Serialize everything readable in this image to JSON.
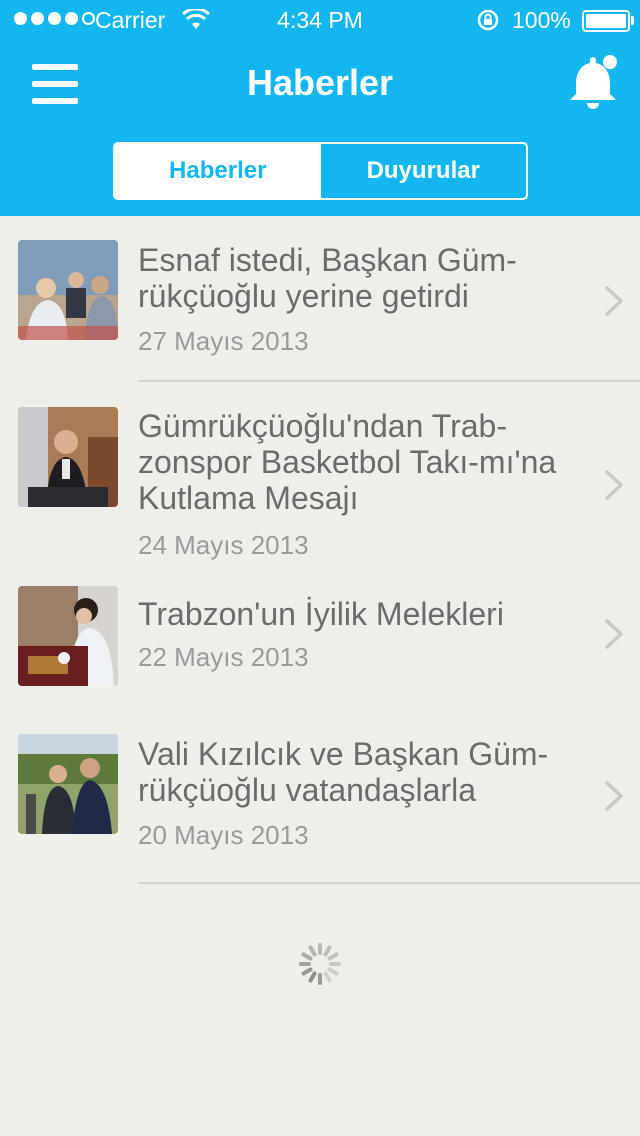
{
  "status_bar": {
    "carrier": "Carrier",
    "time": "4:34 PM",
    "battery": "100%"
  },
  "nav": {
    "title": "Haberler",
    "menu_icon": "hamburger-menu-icon",
    "bell_icon": "bell-icon"
  },
  "tabs": [
    {
      "label": "Haberler",
      "active": true
    },
    {
      "label": "Duyurular",
      "active": false
    }
  ],
  "news": [
    {
      "title": "Esnaf istedi, Başkan Güm-rükçüoğlu yerine getirdi",
      "date": "27 Mayıs 2013"
    },
    {
      "title": "Gümrükçüoğlu'ndan Trab-zonspor Basketbol Takı-mı'na Kutlama Mesajı",
      "date": "24 Mayıs 2013"
    },
    {
      "title": "Trabzon'un İyilik Melekleri",
      "date": "22 Mayıs 2013"
    },
    {
      "title": "Vali Kızılcık ve Başkan Güm-rükçüoğlu vatandaşlarla",
      "date": "20 Mayıs 2013"
    }
  ],
  "colors": {
    "accent": "#14b6ef",
    "background": "#efefea"
  }
}
